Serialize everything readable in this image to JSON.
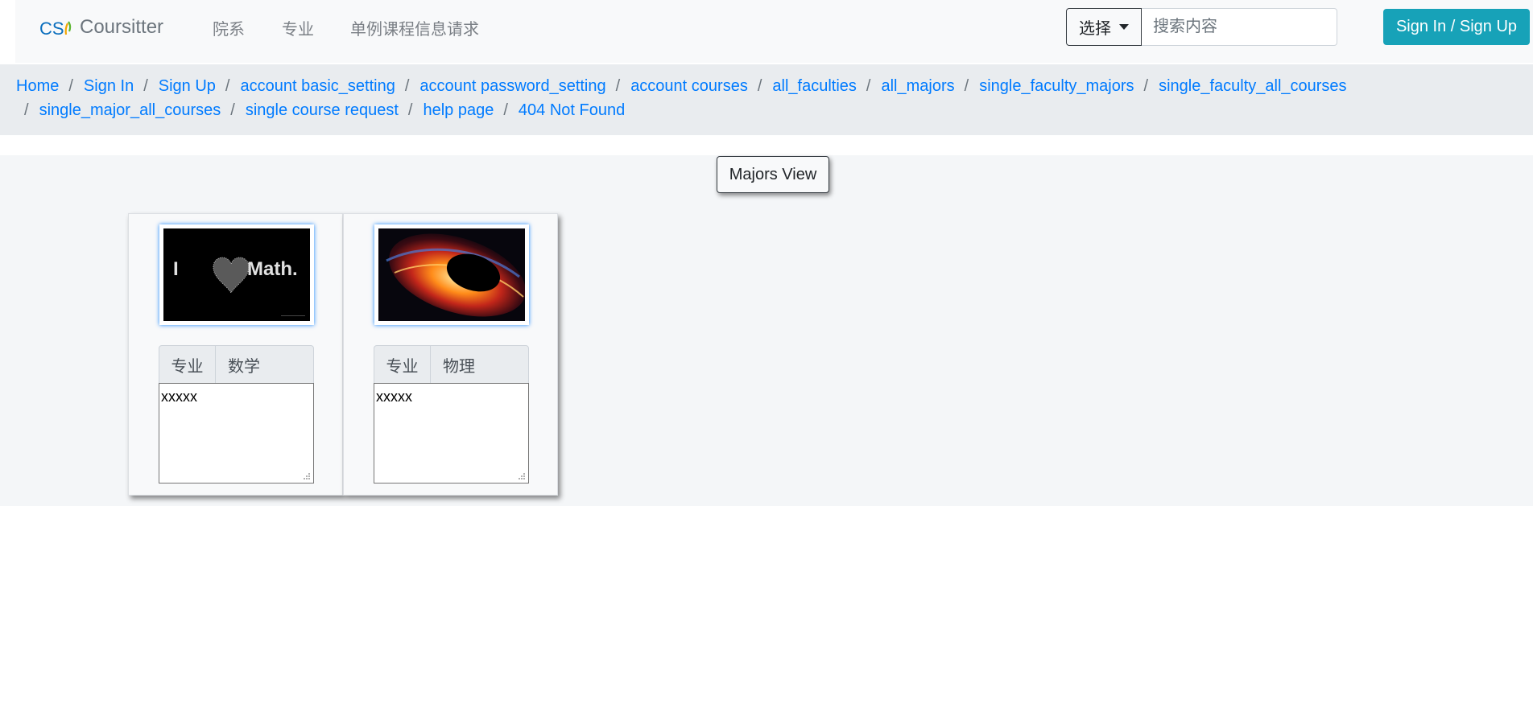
{
  "navbar": {
    "brand_logo_text": "CS",
    "brand_name": "Coursitter",
    "links": [
      {
        "label": "院系"
      },
      {
        "label": "专业"
      },
      {
        "label": "单例课程信息请求"
      }
    ],
    "select_label": "选择",
    "search_placeholder": "搜索内容",
    "signin_label": "Sign In / Sign Up"
  },
  "breadcrumb": {
    "items": [
      "Home",
      "Sign In",
      "Sign Up",
      "account basic_setting",
      "account password_setting",
      "account courses",
      "all_faculties",
      "all_majors",
      "single_faculty_majors",
      "single_faculty_all_courses",
      "single_major_all_courses",
      "single course request",
      "help page",
      "404 Not Found"
    ],
    "separator": "/"
  },
  "main": {
    "view_button_label": "Majors View",
    "cards": [
      {
        "image_caption": "I ♥ Math.",
        "image_text_left": "I",
        "image_text_right": "Math.",
        "prefix": "专业",
        "major": "数学",
        "description": "xxxxx"
      },
      {
        "image_caption": "black hole",
        "prefix": "专业",
        "major": "物理",
        "description": "xxxxx"
      }
    ]
  },
  "colors": {
    "brand_blue": "#0a6ebd",
    "link_blue": "#007bff",
    "info_button": "#17a2b8",
    "navbar_bg": "#f8f9fa",
    "breadcrumb_bg": "#e9ecef"
  }
}
